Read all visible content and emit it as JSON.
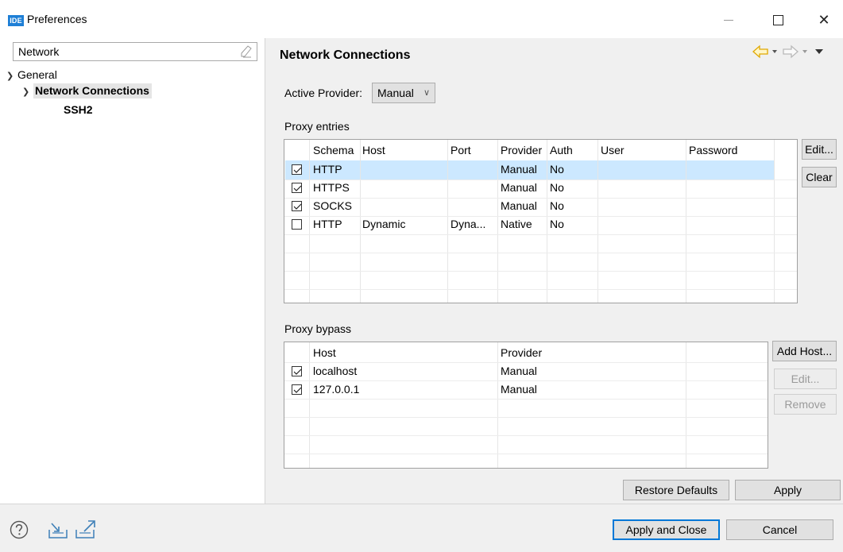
{
  "window": {
    "title": "Preferences",
    "app_icon_text": "IDE",
    "close_glyph": "✕"
  },
  "filter": {
    "value": "Network",
    "clear_icon": "clear-filter-icon"
  },
  "tree": {
    "items": [
      {
        "label": "General",
        "expanded": true,
        "level": 0
      },
      {
        "label": "Network Connections",
        "expanded": true,
        "level": 1,
        "selected": true
      },
      {
        "label": "SSH2",
        "level": 2
      }
    ]
  },
  "page": {
    "title": "Network Connections",
    "active_provider_label": "Active Provider:",
    "active_provider_value": "Manual"
  },
  "proxy_entries": {
    "label": "Proxy entries",
    "columns": [
      "Schema",
      "Host",
      "Port",
      "Provider",
      "Auth",
      "User",
      "Password"
    ],
    "rows": [
      {
        "checked": true,
        "schema": "HTTP",
        "host": "",
        "port": "",
        "provider": "Manual",
        "auth": "No",
        "user": "",
        "password": "",
        "selected": true
      },
      {
        "checked": true,
        "schema": "HTTPS",
        "host": "",
        "port": "",
        "provider": "Manual",
        "auth": "No",
        "user": "",
        "password": ""
      },
      {
        "checked": true,
        "schema": "SOCKS",
        "host": "",
        "port": "",
        "provider": "Manual",
        "auth": "No",
        "user": "",
        "password": ""
      },
      {
        "checked": false,
        "schema": "HTTP",
        "host": "Dynamic",
        "port": "Dyna...",
        "provider": "Native",
        "auth": "No",
        "user": "",
        "password": ""
      }
    ],
    "buttons": {
      "edit": "Edit...",
      "clear": "Clear"
    }
  },
  "proxy_bypass": {
    "label": "Proxy bypass",
    "columns": [
      "Host",
      "Provider"
    ],
    "rows": [
      {
        "checked": true,
        "host": "localhost",
        "provider": "Manual"
      },
      {
        "checked": true,
        "host": "127.0.0.1",
        "provider": "Manual"
      }
    ],
    "buttons": {
      "add_host": "Add Host...",
      "edit": "Edit...",
      "remove": "Remove"
    }
  },
  "actions": {
    "restore_defaults": "Restore Defaults",
    "apply": "Apply",
    "apply_and_close": "Apply and Close",
    "cancel": "Cancel"
  },
  "colors": {
    "accent": "#0078d7",
    "selection": "#cce8ff",
    "nav_arrow_active": "#f0b400"
  },
  "icons": {
    "help": "help-icon",
    "import": "import-icon",
    "export": "export-icon",
    "back": "back-arrow-icon",
    "forward": "forward-arrow-icon",
    "menu": "view-menu-icon"
  }
}
